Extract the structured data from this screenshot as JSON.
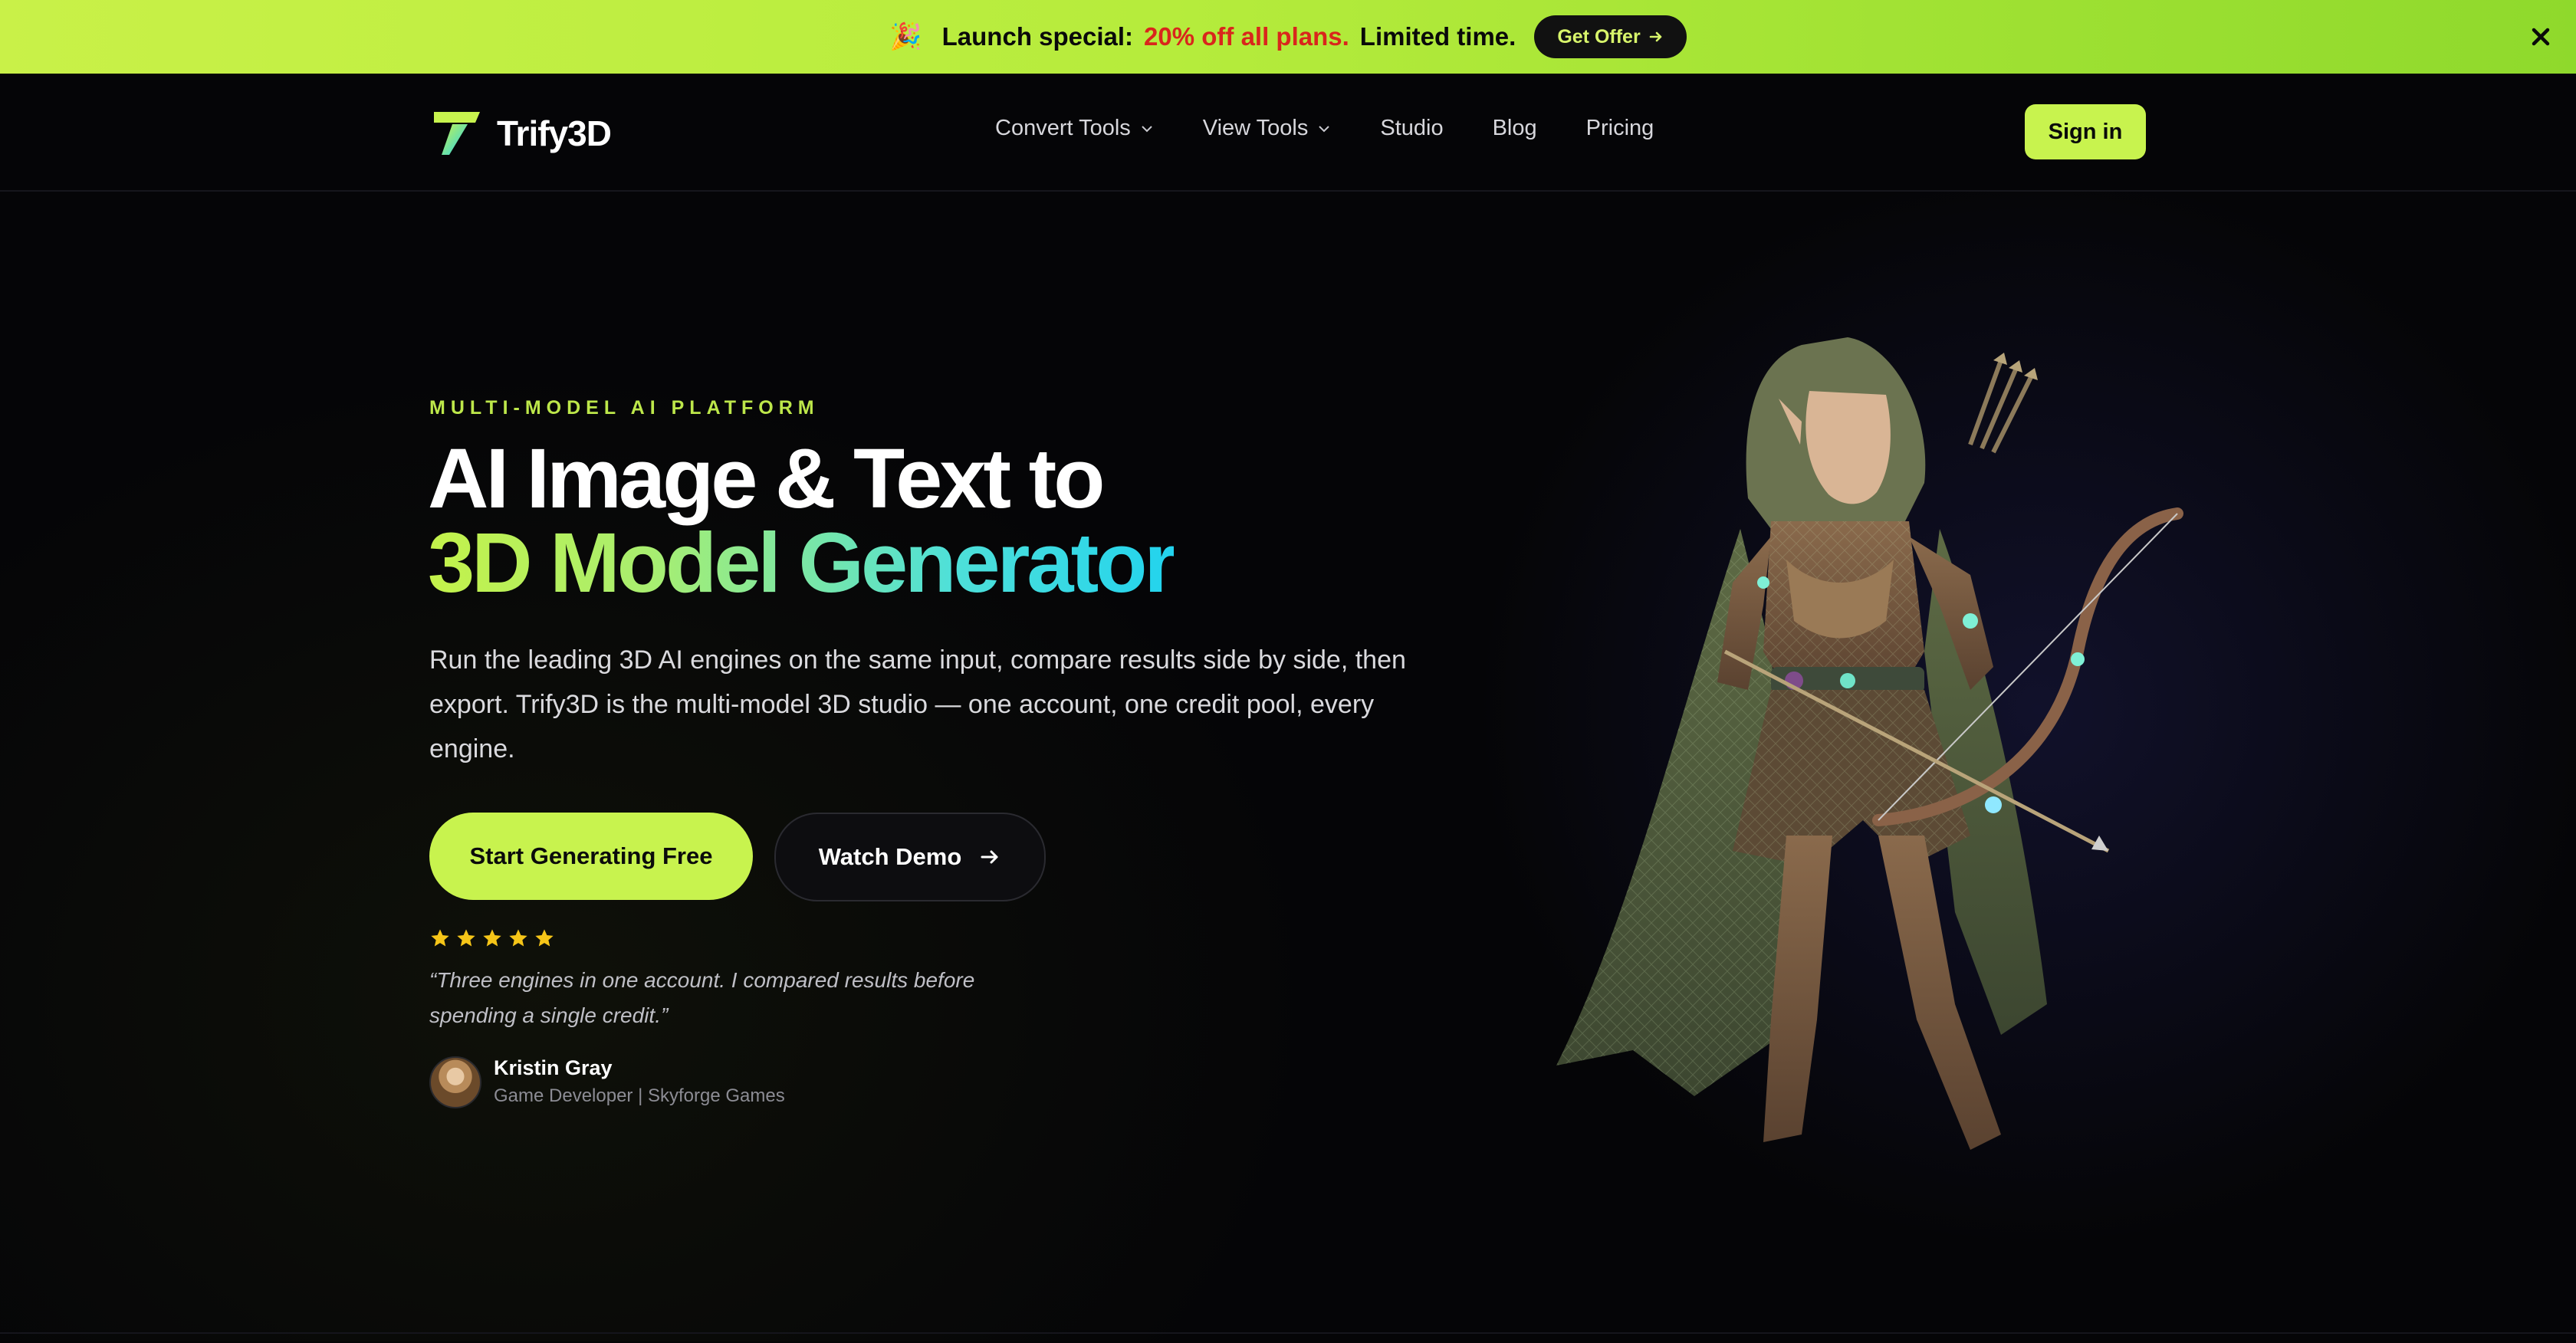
{
  "promo": {
    "emoji": "🎉",
    "label": "Launch special:",
    "highlight": "20% off all plans.",
    "suffix": "Limited time.",
    "button_label": "Get Offer",
    "colors": {
      "background": "#b6ec3c",
      "highlight": "#d9261c"
    }
  },
  "nav": {
    "logo_text": "Trify3D",
    "links": [
      {
        "label": "Convert Tools",
        "has_dropdown": true
      },
      {
        "label": "View Tools",
        "has_dropdown": true
      },
      {
        "label": "Studio",
        "has_dropdown": false
      },
      {
        "label": "Blog",
        "has_dropdown": false
      },
      {
        "label": "Pricing",
        "has_dropdown": false
      }
    ],
    "signin_label": "Sign in"
  },
  "hero": {
    "eyebrow": "MULTI-MODEL AI PLATFORM",
    "headline_line1": "AI Image & Text to",
    "headline_line2": "3D Model Generator",
    "description": "Run the leading 3D AI engines on the same input, compare results side by side, then export. Trify3D is the multi-model 3D studio — one account, one credit pool, every engine.",
    "cta_primary": "Start Generating Free",
    "cta_secondary": "Watch Demo",
    "rating_stars": 5,
    "quote": "“Three engines in one account. I compared results before spending a single credit.”",
    "author_name": "Kristin Gray",
    "author_role": "Game Developer | Skyforge Games",
    "image_subject": "elf-archer-3d-model",
    "colors": {
      "accent": "#c8f34e",
      "gradient_end": "#22d3ee",
      "star": "#f5c518"
    }
  }
}
